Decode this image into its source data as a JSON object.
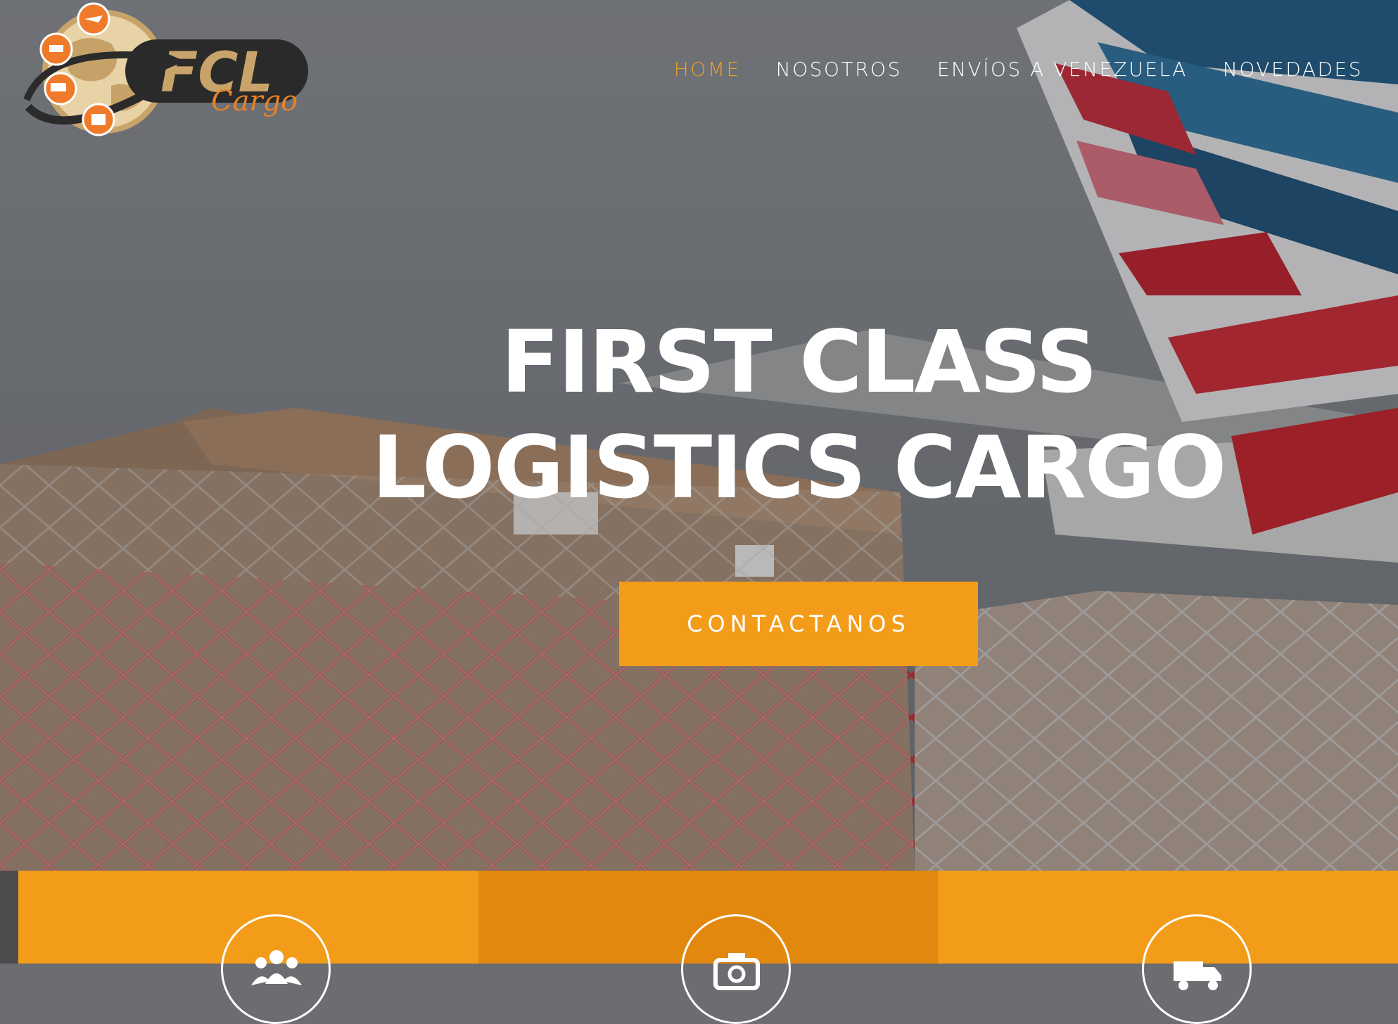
{
  "brand": {
    "name": "FCL",
    "tagline": "Cargo",
    "logo_icon": "globe-logistics-logo"
  },
  "nav": {
    "items": [
      {
        "label": "HOME",
        "active": true
      },
      {
        "label": "NOSOTROS",
        "active": false
      },
      {
        "label": "ENVÍOS A VENEZUELA",
        "active": false
      },
      {
        "label": "NOVEDADES",
        "active": false
      }
    ]
  },
  "hero": {
    "headline_line1": "FIRST CLASS",
    "headline_line2": "LOGISTICS CARGO",
    "cta_label": "CONTACTANOS"
  },
  "features": [
    {
      "icon": "users-icon"
    },
    {
      "icon": "camera-icon"
    },
    {
      "icon": "truck-icon"
    }
  ],
  "colors": {
    "accent": "#f39c19",
    "accent_dark": "#e2880f",
    "nav_active": "#f0a01f",
    "text": "#ffffff"
  }
}
